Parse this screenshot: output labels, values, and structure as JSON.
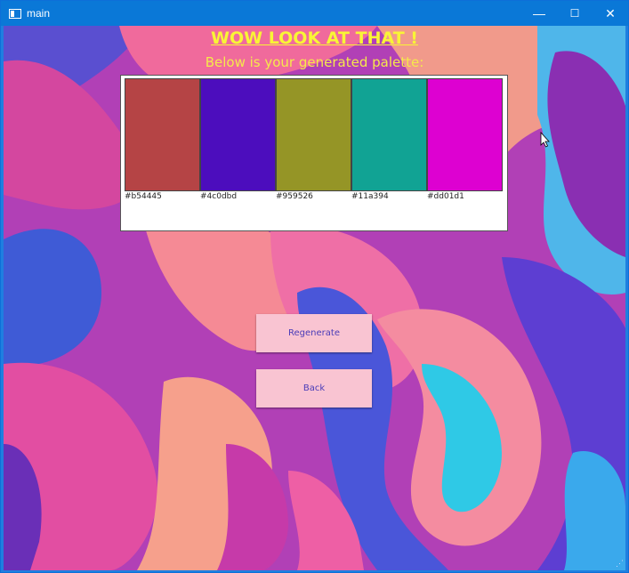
{
  "window": {
    "title": "main",
    "controls": {
      "minimize": "—",
      "maximize": "☐",
      "close": "✕"
    }
  },
  "header": {
    "title": "WOW LOOK AT THAT !",
    "subtitle": "Below is your generated palette:"
  },
  "palette": {
    "swatches": [
      {
        "label": "#b54445",
        "color": "#b54445"
      },
      {
        "label": "#4c0dbd",
        "color": "#4c0dbd"
      },
      {
        "label": "#959526",
        "color": "#959526"
      },
      {
        "label": "#11a394",
        "color": "#11a394"
      },
      {
        "label": "#dd01d1",
        "color": "#dd01d1"
      }
    ]
  },
  "buttons": {
    "regenerate": "Regenerate",
    "back": "Back"
  },
  "colors": {
    "title_yellow": "#f9f535",
    "button_bg": "#f9c4d2",
    "button_text": "#4a3cb8",
    "titlebar": "#0a78d7"
  }
}
